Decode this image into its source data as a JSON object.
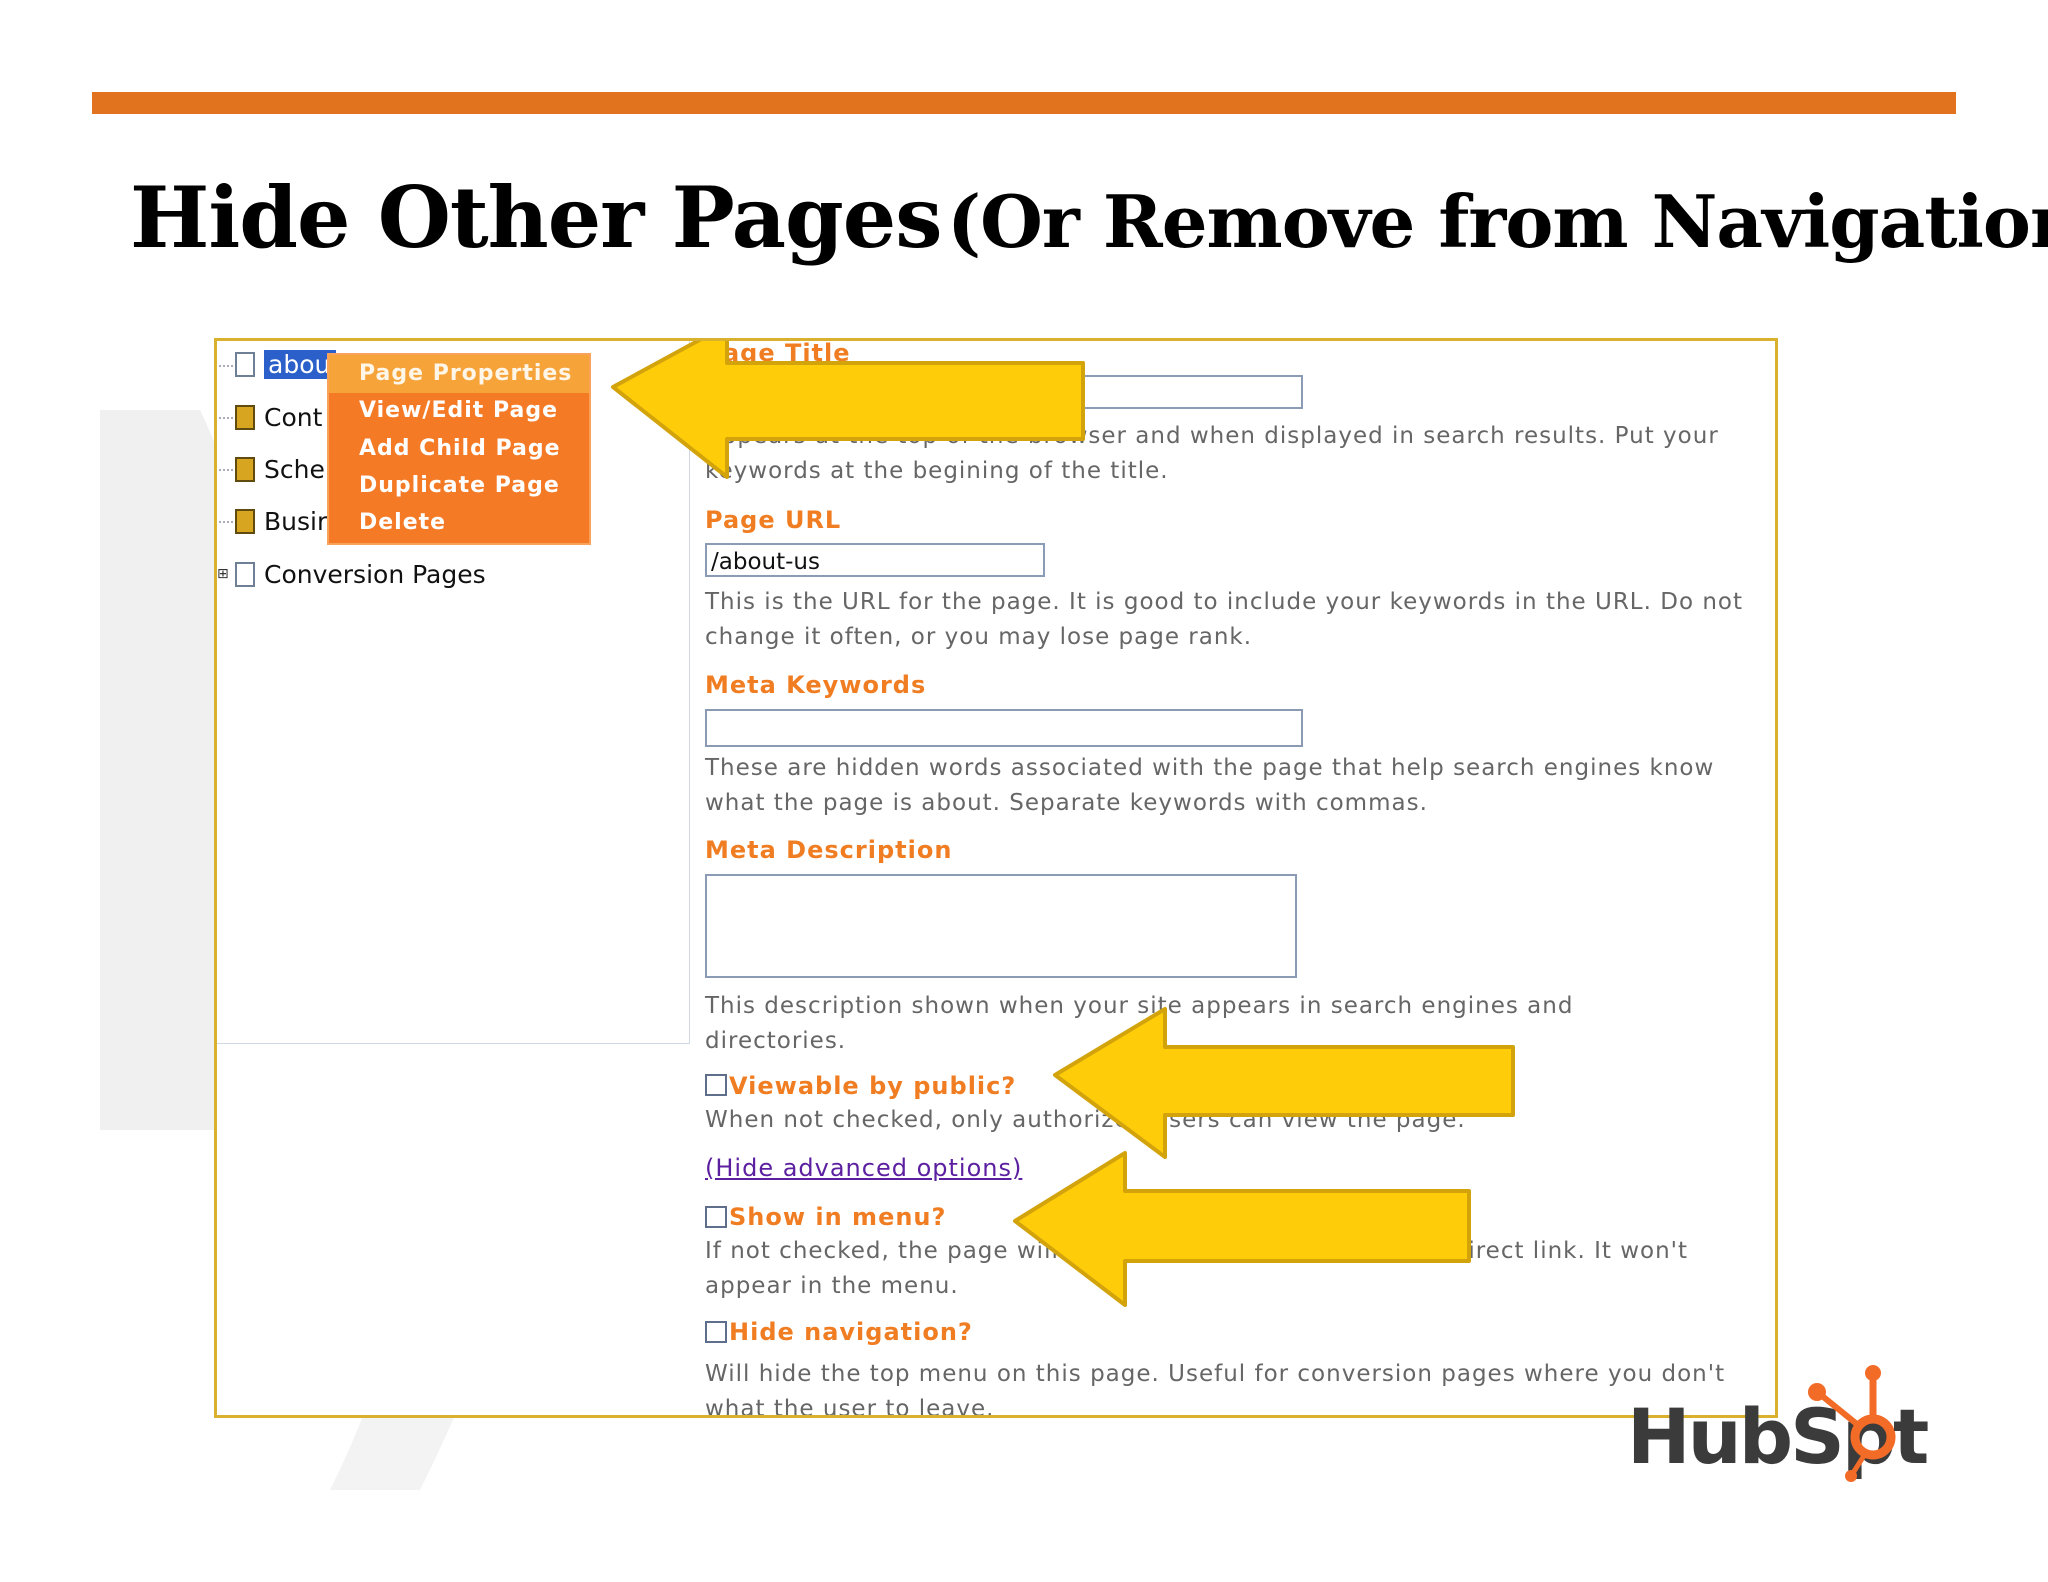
{
  "slide": {
    "title_main": "Hide Other Pages",
    "title_sub": "(Or Remove from Navigation)",
    "accent_color": "#e1731f",
    "logo_text": "HubSpot"
  },
  "tree": {
    "items": [
      {
        "label": "abou",
        "icon": "file-icon",
        "selected": true
      },
      {
        "label": "Cont",
        "icon": "lock-icon"
      },
      {
        "label": "Sche",
        "icon": "lock-icon"
      },
      {
        "label": "Busir",
        "icon": "lock-icon"
      },
      {
        "label": "Conversion Pages",
        "icon": "file-icon",
        "expander": "⊞"
      }
    ]
  },
  "context_menu": {
    "items": [
      "Page Properties",
      "View/Edit Page",
      "Add Child Page",
      "Duplicate Page",
      "Delete"
    ]
  },
  "form": {
    "page_title_label": "Page Title",
    "page_title_help": "Appears at the top of the browser and when displayed in search results. Put your keywords at the begining of the title.",
    "page_url_label": "Page URL",
    "page_url_value": "/about-us",
    "page_url_help": "This is the URL for the page. It is good to include your keywords in the URL. Do not change it often, or you may lose page rank.",
    "meta_keywords_label": "Meta Keywords",
    "meta_keywords_help": "These are hidden words associated with the page that help search engines know what the page is about. Separate keywords with commas.",
    "meta_description_label": "Meta Description",
    "meta_description_help": "This description shown when your site appears in search engines and directories.",
    "viewable_label": "Viewable by public?",
    "viewable_help": "When not checked, only authorized users can view the page.",
    "advanced_link": "(Hide advanced options)",
    "show_menu_label": "Show in menu?",
    "show_menu_help": "If not checked, the page will only be viewed via following a direct link. It won't appear in the menu.",
    "hide_nav_label": "Hide navigation?",
    "hide_nav_help": "Will hide the top menu on this page. Useful for conversion pages where you don't what the user to leave."
  }
}
